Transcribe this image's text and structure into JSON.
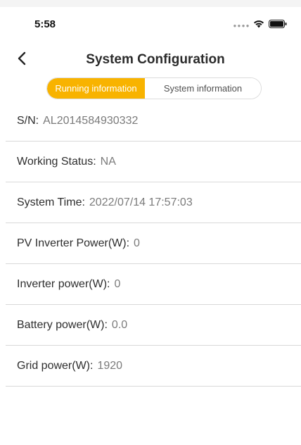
{
  "status_bar": {
    "time": "5:58",
    "signal_icon": "signal-dots-icon",
    "wifi_icon": "wifi-icon",
    "battery_icon": "battery-icon"
  },
  "nav": {
    "back_icon": "chevron-left-icon",
    "title": "System Configuration"
  },
  "tabs": [
    {
      "label": "Running information",
      "active": true
    },
    {
      "label": "System information",
      "active": false
    }
  ],
  "accent_color": "#f8b300",
  "rows": [
    {
      "label": "S/N:",
      "value": "AL2014584930332"
    },
    {
      "label": "Working Status:",
      "value": "NA"
    },
    {
      "label": "System Time:",
      "value": "2022/07/14 17:57:03"
    },
    {
      "label": "PV Inverter Power(W):",
      "value": "0"
    },
    {
      "label": "Inverter power(W):",
      "value": "0"
    },
    {
      "label": "Battery power(W):",
      "value": "0.0"
    },
    {
      "label": "Grid power(W):",
      "value": "1920"
    }
  ]
}
